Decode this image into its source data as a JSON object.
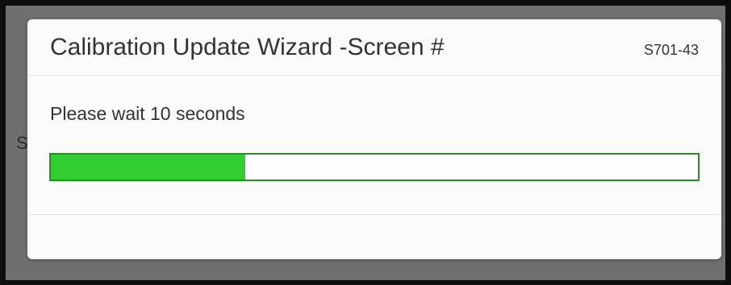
{
  "dialog": {
    "title": "Calibration Update Wizard -Screen #",
    "screen_code": "S701-43",
    "message": "Please wait 10 seconds",
    "progress": 0.3,
    "progress_color": "#33cc33",
    "progress_border_color": "#2d8a2d"
  },
  "backdrop": {
    "partial_text": "S"
  }
}
